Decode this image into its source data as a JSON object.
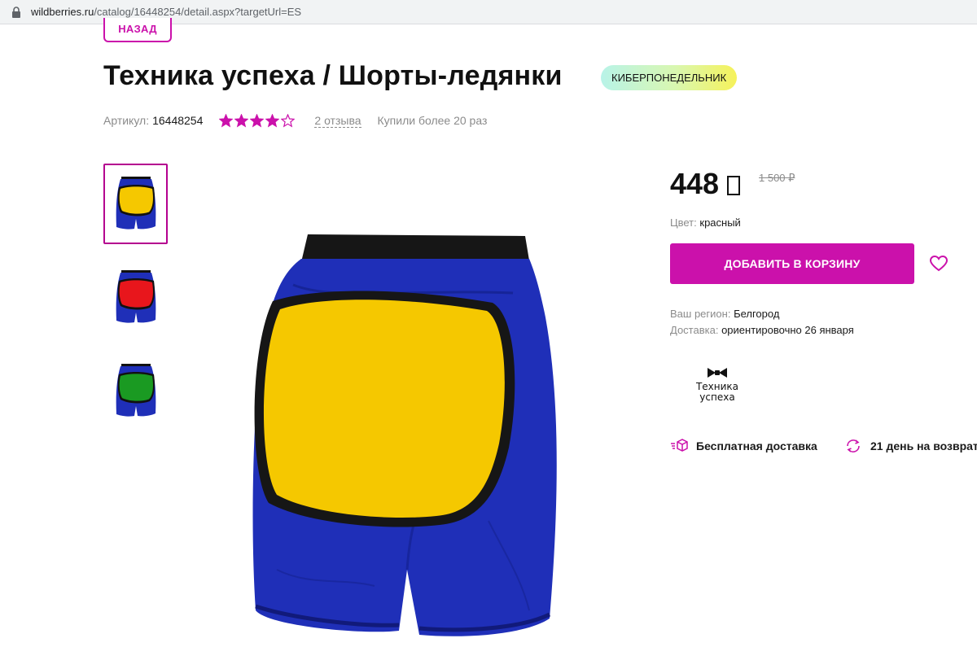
{
  "browser": {
    "url_domain": "wildberries.ru",
    "url_path": "/catalog/16448254/detail.aspx?targetUrl=ES"
  },
  "nav": {
    "back_label": "НАЗАД"
  },
  "product": {
    "title": "Техника успеха / Шорты-ледянки",
    "promo_badge": "КИБЕРПОНЕДЕЛЬНИК",
    "sku_label": "Артикул:",
    "sku_value": "16448254",
    "rating": 4,
    "rating_max": 5,
    "reviews": "2 отзыва",
    "bought": "Купили более 20 раз"
  },
  "gallery": {
    "thumbnails": [
      {
        "color_name": "yellow",
        "patch_color": "#f5c800",
        "active": true
      },
      {
        "color_name": "red",
        "patch_color": "#e8161c",
        "active": false
      },
      {
        "color_name": "green",
        "patch_color": "#1a9a22",
        "active": false
      }
    ],
    "shorts_color": "#1f2fb8"
  },
  "pricing": {
    "price": "448",
    "old_price": "1 500 ₽"
  },
  "options": {
    "color_label": "Цвет:",
    "color_value": "красный"
  },
  "actions": {
    "add_to_cart": "ДОБАВИТЬ В КОРЗИНУ"
  },
  "delivery": {
    "region_label": "Ваш регион:",
    "region_value": "Белгород",
    "delivery_label": "Доставка:",
    "delivery_value": "ориентировочно 26 января"
  },
  "brand": {
    "name_line1": "Техника",
    "name_line2": "успеха"
  },
  "features": {
    "free_delivery": "Бесплатная доставка",
    "returns": "21 день на возврат"
  },
  "colors": {
    "accent": "#cb11ab",
    "muted_text": "#8b8b8b"
  }
}
